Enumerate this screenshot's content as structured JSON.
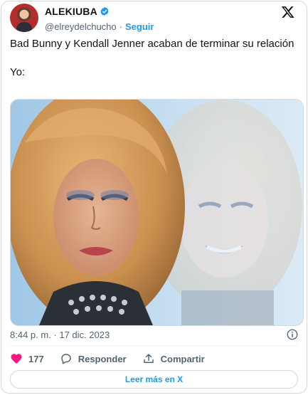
{
  "author": {
    "display_name": "ALEKIUBA",
    "handle": "@elreydelchucho",
    "separator": "·",
    "follow_label": "Seguir"
  },
  "tweet": {
    "text": "Bad Bunny y Kendall Jenner acaban de terminar su relación\n\nYo:",
    "timestamp": "8:44 p. m. · 17 dic. 2023"
  },
  "actions": {
    "like_count": "177",
    "reply_label": "Responder",
    "share_label": "Compartir"
  },
  "read_more_label": "Leer más en X",
  "colors": {
    "accent": "#1d9bf0",
    "like": "#f91880",
    "secondary_text": "#536471",
    "border": "#cfd9de"
  },
  "icons": [
    "verified-badge-icon",
    "x-logo-icon",
    "info-icon",
    "heart-icon",
    "reply-icon",
    "share-icon"
  ]
}
